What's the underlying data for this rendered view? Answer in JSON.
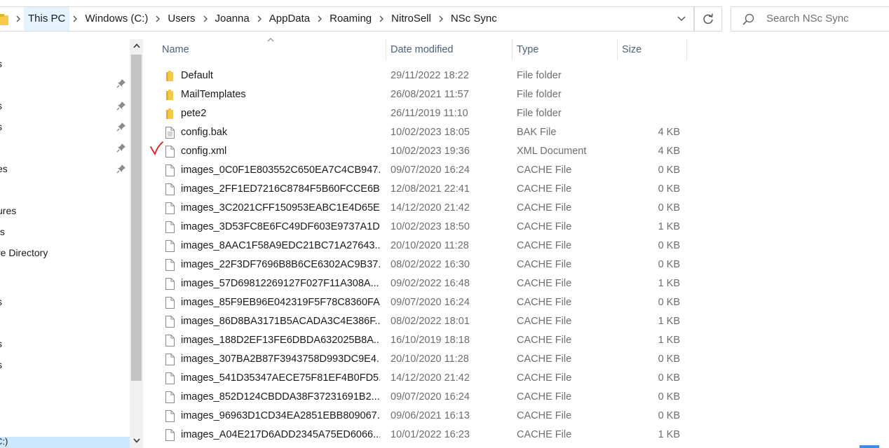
{
  "breadcrumb": [
    "This PC",
    "Windows (C:)",
    "Users",
    "Joanna",
    "AppData",
    "Roaming",
    "NitroSell",
    "NSc Sync"
  ],
  "search": {
    "placeholder": "Search NSc Sync"
  },
  "nav": {
    "items": [
      {
        "label": "s",
        "pinned": false
      },
      {
        "label": "",
        "pinned": true
      },
      {
        "label": "s",
        "pinned": true
      },
      {
        "label": "s",
        "pinned": true
      },
      {
        "label": "",
        "pinned": true
      },
      {
        "label": "es",
        "pinned": true
      },
      {
        "label": "",
        "pinned": false
      },
      {
        "label": "ures",
        "pinned": false
      },
      {
        "label": "ts",
        "pinned": false
      },
      {
        "label": "re Directory",
        "pinned": false
      },
      {
        "label": "",
        "pinned": false
      },
      {
        "label": "s",
        "pinned": false
      },
      {
        "label": "",
        "pinned": false
      },
      {
        "label": "s",
        "pinned": false
      },
      {
        "label": "s",
        "pinned": false
      }
    ],
    "bottom_label": "C:)"
  },
  "columns": {
    "name": "Name",
    "date": "Date modified",
    "type": "Type",
    "size": "Size"
  },
  "files": [
    {
      "name": "Default",
      "date": "29/11/2022 18:22",
      "type": "File folder",
      "size": "",
      "kind": "folder"
    },
    {
      "name": "MailTemplates",
      "date": "26/08/2021 11:57",
      "type": "File folder",
      "size": "",
      "kind": "folder"
    },
    {
      "name": "pete2",
      "date": "26/11/2019 11:10",
      "type": "File folder",
      "size": "",
      "kind": "folder"
    },
    {
      "name": "config.bak",
      "date": "10/02/2023 18:05",
      "type": "BAK File",
      "size": "4 KB",
      "kind": "text"
    },
    {
      "name": "config.xml",
      "date": "10/02/2023 19:36",
      "type": "XML Document",
      "size": "4 KB",
      "kind": "file"
    },
    {
      "name": "images_0C0F1E803552C650EA7C4CB947...",
      "date": "09/07/2020 16:24",
      "type": "CACHE File",
      "size": "0 KB",
      "kind": "file"
    },
    {
      "name": "images_2FF1ED7216C8784F5B60FCCE6B...",
      "date": "12/08/2021 22:41",
      "type": "CACHE File",
      "size": "0 KB",
      "kind": "file"
    },
    {
      "name": "images_3C2021CFF150953EABC1E4D65E...",
      "date": "14/12/2020 21:42",
      "type": "CACHE File",
      "size": "0 KB",
      "kind": "file"
    },
    {
      "name": "images_3D53FC8E6FC49DF603E9737A1D...",
      "date": "10/02/2023 18:50",
      "type": "CACHE File",
      "size": "1 KB",
      "kind": "file"
    },
    {
      "name": "images_8AAC1F58A9EDC21BC71A27643...",
      "date": "20/10/2020 11:28",
      "type": "CACHE File",
      "size": "0 KB",
      "kind": "file"
    },
    {
      "name": "images_22F3DF7696B8B6CE6302AC9B37...",
      "date": "08/02/2022 16:30",
      "type": "CACHE File",
      "size": "0 KB",
      "kind": "file"
    },
    {
      "name": "images_57D69812269127F027F11A308A...",
      "date": "09/02/2022 16:48",
      "type": "CACHE File",
      "size": "1 KB",
      "kind": "file"
    },
    {
      "name": "images_85F9EB96E042319F5F78C8360FA...",
      "date": "09/07/2020 16:24",
      "type": "CACHE File",
      "size": "0 KB",
      "kind": "file"
    },
    {
      "name": "images_86D8BA3171B5ACADA3C4E386F...",
      "date": "08/02/2022 18:01",
      "type": "CACHE File",
      "size": "1 KB",
      "kind": "file"
    },
    {
      "name": "images_188D2EF13FE6DBDA632025B8A...",
      "date": "16/10/2019 18:18",
      "type": "CACHE File",
      "size": "1 KB",
      "kind": "file"
    },
    {
      "name": "images_307BA2B87F3943758D993DC9E4...",
      "date": "20/10/2020 11:28",
      "type": "CACHE File",
      "size": "0 KB",
      "kind": "file"
    },
    {
      "name": "images_541D35347AECE75F81EF4B0FD5...",
      "date": "14/12/2020 21:42",
      "type": "CACHE File",
      "size": "0 KB",
      "kind": "file"
    },
    {
      "name": "images_852D124CBDDA38F37231691B2...",
      "date": "09/07/2020 16:24",
      "type": "CACHE File",
      "size": "0 KB",
      "kind": "file"
    },
    {
      "name": "images_96963D1CD34EA2851EBB809067...",
      "date": "09/06/2021 16:13",
      "type": "CACHE File",
      "size": "0 KB",
      "kind": "file"
    },
    {
      "name": "images_A04E217D6ADD2345A75ED6066...",
      "date": "10/01/2022 16:23",
      "type": "CACHE File",
      "size": "1 KB",
      "kind": "file"
    }
  ],
  "colors": {
    "folder": "#f7c948",
    "selection": "#cce8ff",
    "header_text": "#4c607a",
    "annotation": "#e02020"
  }
}
